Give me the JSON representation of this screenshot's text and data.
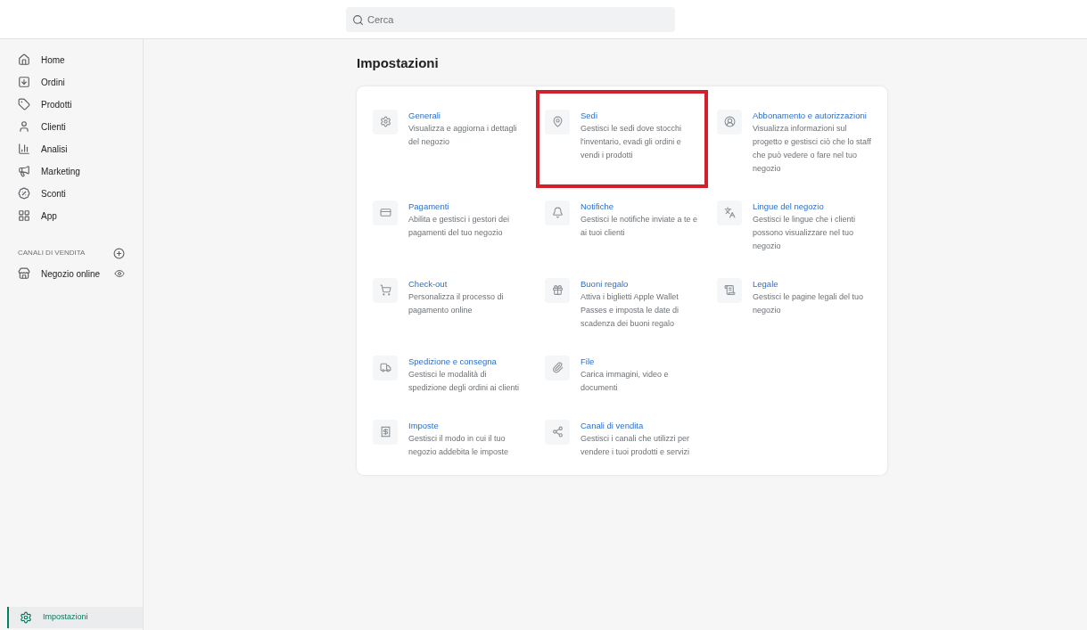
{
  "search": {
    "placeholder": "Cerca"
  },
  "sidebar": {
    "items": [
      {
        "label": "Home",
        "kind": "home"
      },
      {
        "label": "Ordini",
        "kind": "orders"
      },
      {
        "label": "Prodotti",
        "kind": "tag"
      },
      {
        "label": "Clienti",
        "kind": "user"
      },
      {
        "label": "Analisi",
        "kind": "chart"
      },
      {
        "label": "Marketing",
        "kind": "megaphone"
      },
      {
        "label": "Sconti",
        "kind": "discount"
      },
      {
        "label": "App",
        "kind": "apps"
      }
    ],
    "section": {
      "title": "CANALI DI VENDITA",
      "items": [
        {
          "label": "Negozio online",
          "kind": "store"
        }
      ]
    },
    "footer": {
      "label": "Impostazioni",
      "selected": true
    }
  },
  "page_title": "Impostazioni",
  "settings": {
    "rows": [
      [
        {
          "title": "Generali",
          "description": "Visualizza e aggiorna i dettagli del negozio",
          "kind": "gear",
          "highlighted": false
        },
        {
          "title": "Sedi",
          "description": "Gestisci le sedi dove stocchi l'inventario, evadi gli ordini e vendi i prodotti",
          "kind": "pin",
          "highlighted": true
        },
        {
          "title": "Abbonamento e autorizzazioni",
          "description": "Visualizza informazioni sul progetto e gestisci ciò che lo staff che può vedere o fare nel tuo negozio",
          "kind": "account",
          "highlighted": false
        }
      ],
      [
        {
          "title": "Pagamenti",
          "description": "Abilita e gestisci i gestori dei pagamenti del tuo negozio",
          "kind": "payment",
          "highlighted": false
        },
        {
          "title": "Notifiche",
          "description": "Gestisci le notifiche inviate a te e ai tuoi clienti",
          "kind": "bell",
          "highlighted": false
        },
        {
          "title": "Lingue del negozio",
          "description": "Gestisci le lingue che i clienti possono visualizzare nel tuo negozio",
          "kind": "language",
          "highlighted": false
        }
      ],
      [
        {
          "title": "Check-out",
          "description": "Personalizza il processo di pagamento online",
          "kind": "cart",
          "highlighted": false
        },
        {
          "title": "Buoni regalo",
          "description": "Attiva i biglietti Apple Wallet Passes e imposta le date di scadenza dei buoni regalo",
          "kind": "gift",
          "highlighted": false
        },
        {
          "title": "Legale",
          "description": "Gestisci le pagine legali del tuo negozio",
          "kind": "scroll",
          "highlighted": false
        }
      ],
      [
        {
          "title": "Spedizione e consegna",
          "description": "Gestisci le modalità di spedizione degli ordini ai clienti",
          "kind": "truck",
          "highlighted": false
        },
        {
          "title": "File",
          "description": "Carica immagini, video e documenti",
          "kind": "clip",
          "highlighted": false
        }
      ],
      [
        {
          "title": "Imposte",
          "description": "Gestisci il modo in cui il tuo negozio addebita le imposte",
          "kind": "tax",
          "highlighted": false
        },
        {
          "title": "Canali di vendita",
          "description": "Gestisci i canali che utilizzi per vendere i tuoi prodotti e servizi",
          "kind": "channels",
          "highlighted": false
        }
      ]
    ]
  }
}
